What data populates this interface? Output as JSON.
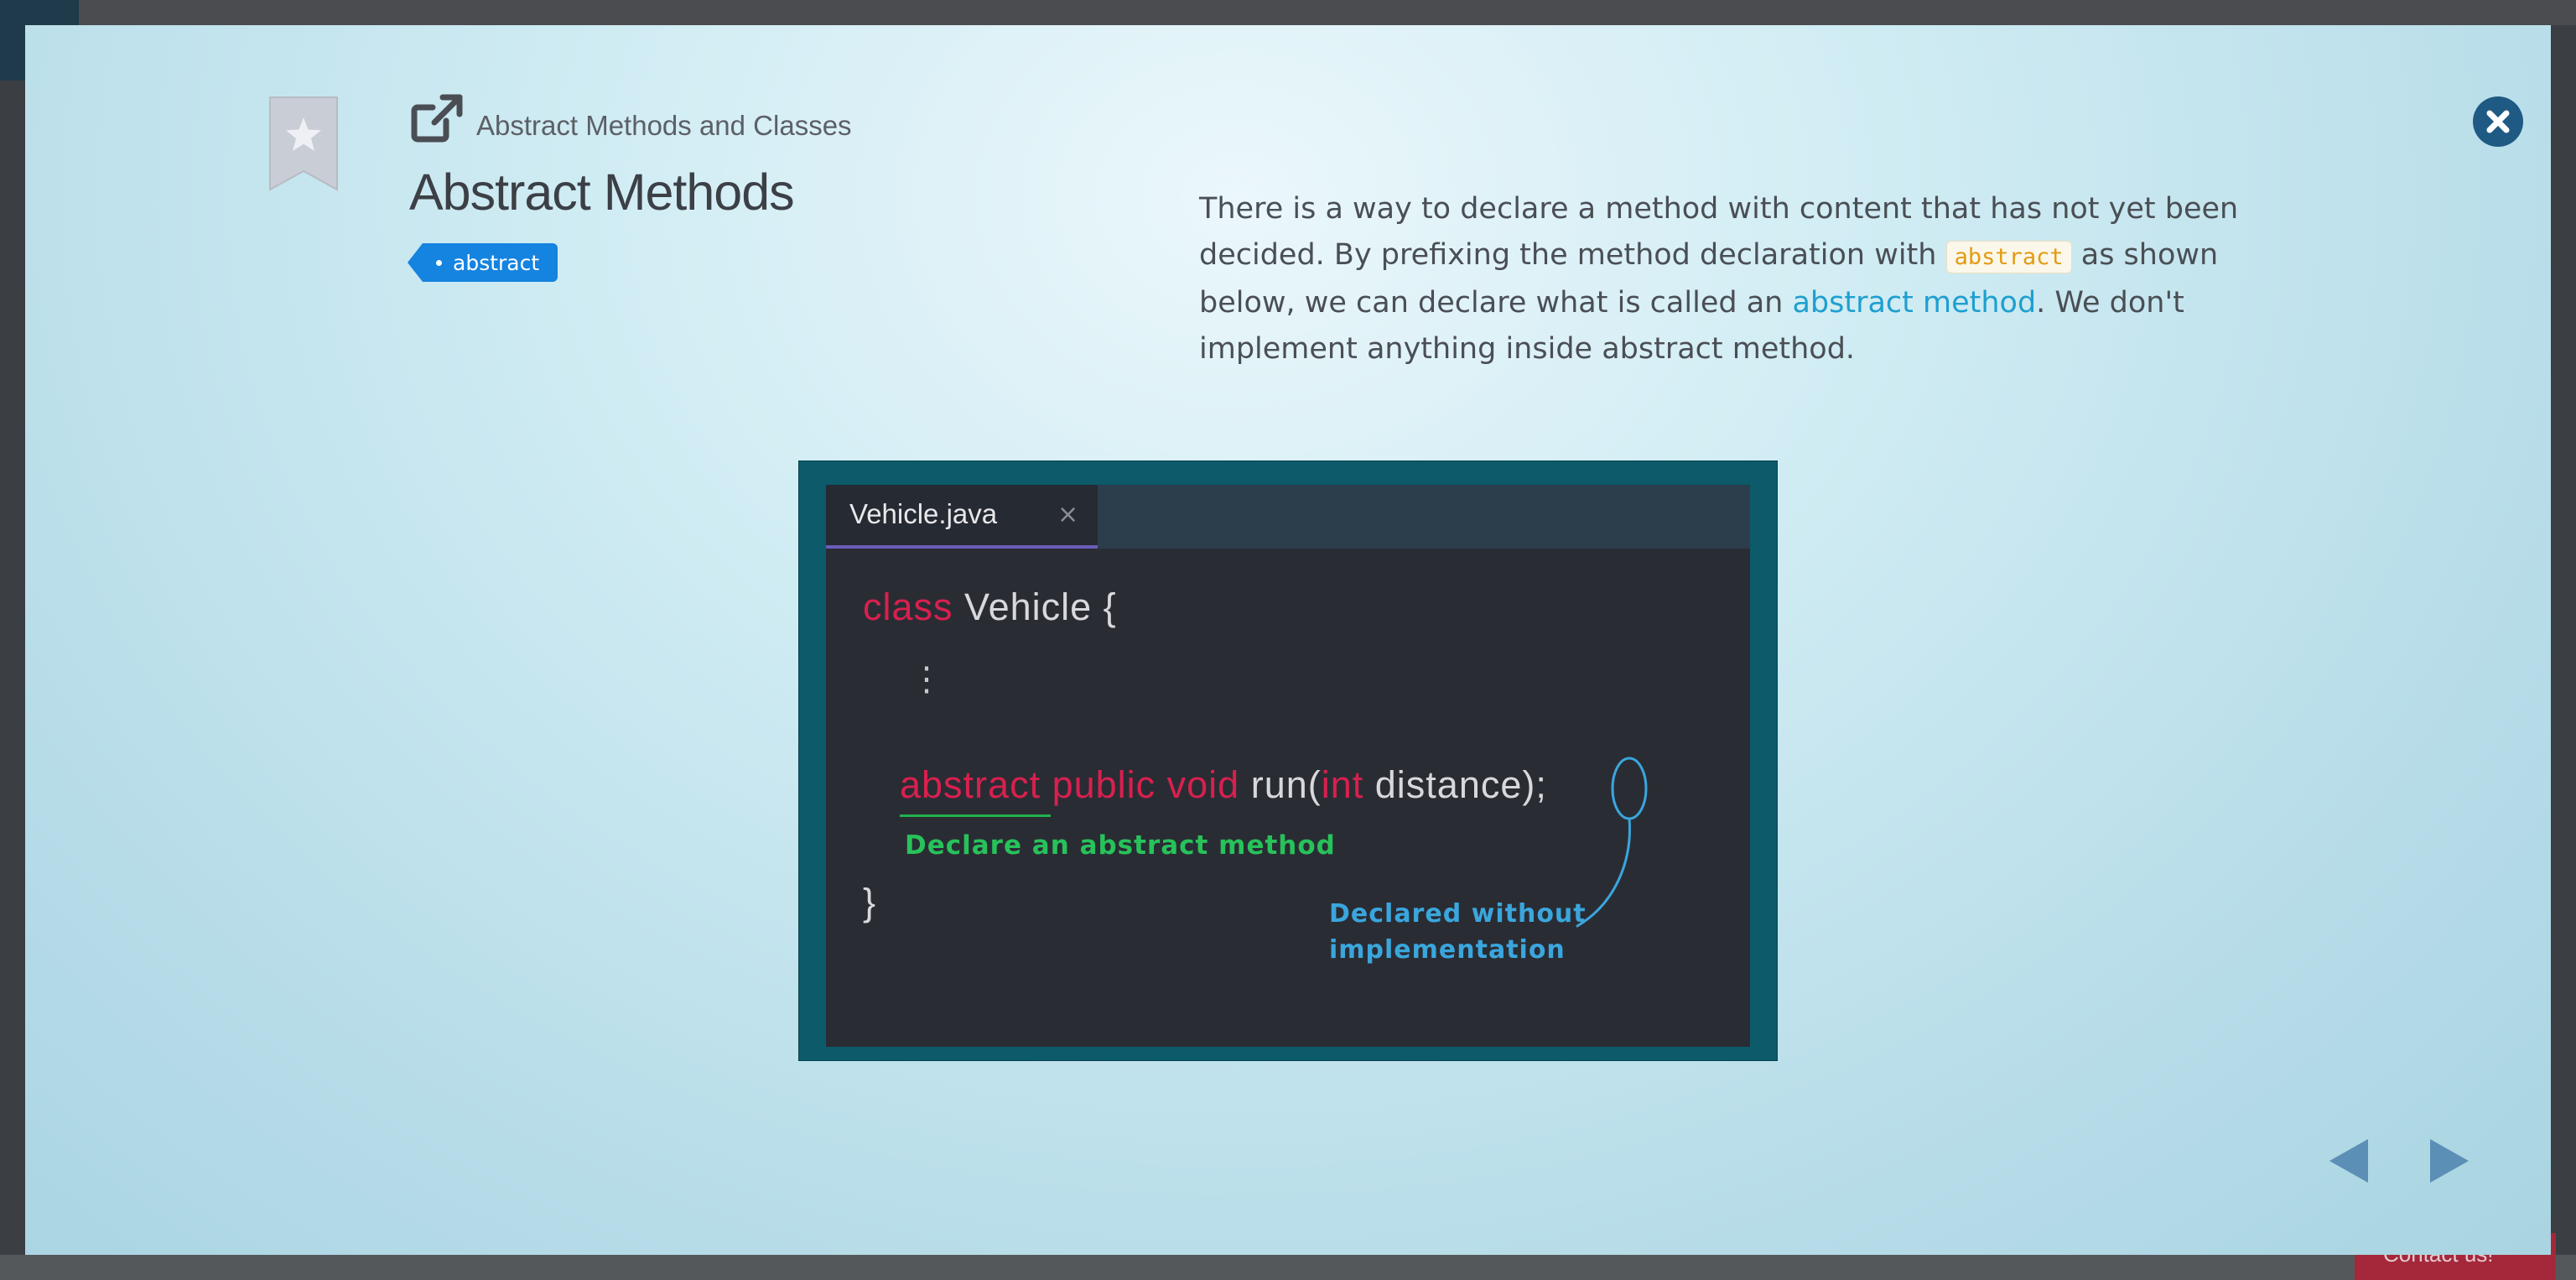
{
  "modal": {
    "breadcrumb": "Abstract Methods and Classes",
    "title": "Abstract Methods",
    "tag": "abstract",
    "description": {
      "part1": "There is a way to declare a method with content that has not yet been decided. By prefixing the method declaration with ",
      "code": "abstract",
      "part2": " as shown below, we can declare what is called an ",
      "link": "abstract method",
      "part3": ". We don't implement anything inside abstract method."
    }
  },
  "figure": {
    "tab_label": "Vehicle.java",
    "tab_close": "×",
    "line1_kw": "class",
    "line1_rest": " Vehicle {",
    "ellipsis": "⋮",
    "line3_kw": "abstract public void",
    "line3_mid": " run(",
    "line3_kw2": "int",
    "line3_rest": " distance)",
    "line3_semicolon": ";",
    "closing_brace": "}",
    "note_green": "Declare an abstract method",
    "note_blue_line1": "Declared without",
    "note_blue_line2": "implementation"
  },
  "background": {
    "contact_label": "Contact us!"
  },
  "colors": {
    "keyword": "#d8204e",
    "tag_blue": "#1583e0",
    "link": "#1e9fd0",
    "annotation_green": "#27c25a",
    "annotation_blue": "#3aa6dd",
    "close_button": "#1e5a84"
  },
  "icons": {
    "bookmark": "bookmark-star-icon",
    "external_link": "external-link-icon",
    "close": "close-circle-icon",
    "prev": "caret-left-icon",
    "next": "caret-right-icon"
  }
}
